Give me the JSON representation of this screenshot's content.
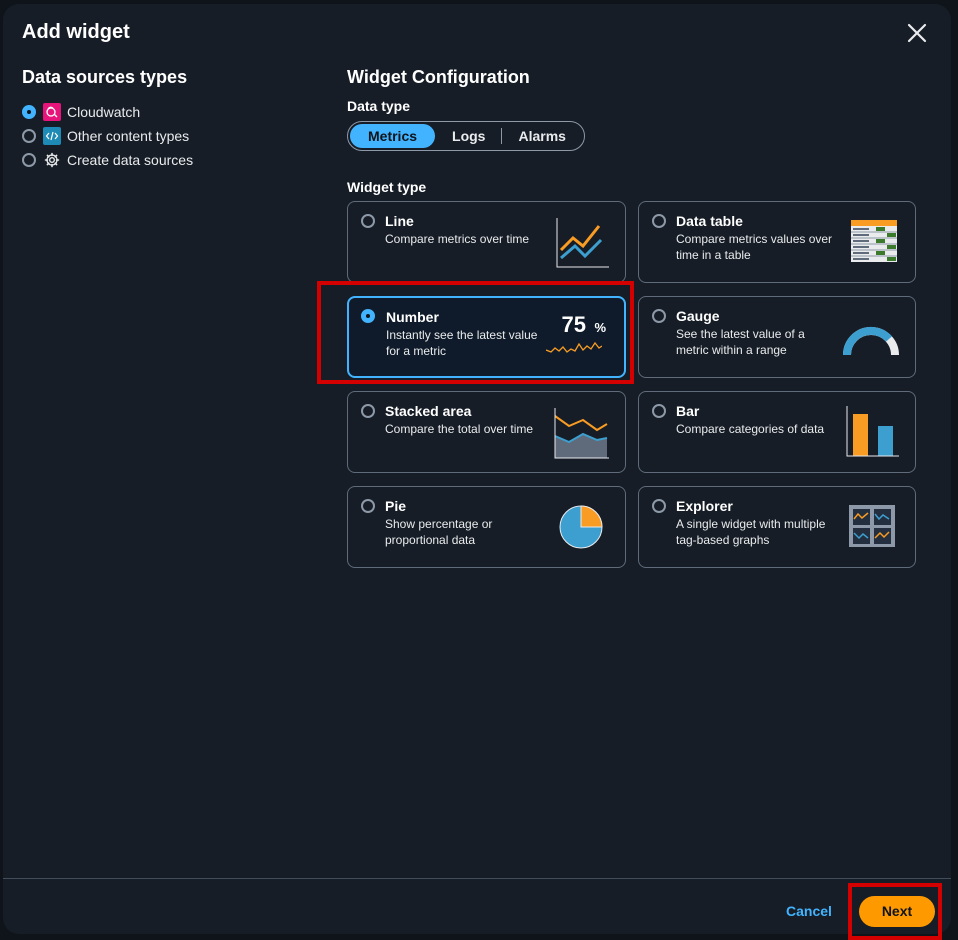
{
  "modal": {
    "title": "Add widget",
    "close_icon": "close-icon"
  },
  "data_sources": {
    "heading": "Data sources types",
    "items": [
      {
        "label": "Cloudwatch",
        "icon": "cloudwatch-icon",
        "selected": true,
        "icon_color": "#e7157b"
      },
      {
        "label": "Other content types",
        "icon": "code-icon",
        "selected": false,
        "icon_color": "#1e8ab6"
      },
      {
        "label": "Create data sources",
        "icon": "gear-icon",
        "selected": false
      }
    ]
  },
  "config": {
    "heading": "Widget Configuration",
    "data_type_label": "Data type",
    "data_types": [
      {
        "label": "Metrics",
        "active": true
      },
      {
        "label": "Logs",
        "active": false
      },
      {
        "label": "Alarms",
        "active": false
      }
    ],
    "widget_type_label": "Widget type",
    "widgets": [
      {
        "title": "Line",
        "desc": "Compare metrics over time",
        "icon": "line-chart-icon",
        "selected": false
      },
      {
        "title": "Data table",
        "desc": "Compare metrics values over time in a table",
        "icon": "data-table-icon",
        "selected": false
      },
      {
        "title": "Number",
        "desc": "Instantly see the latest value for a metric",
        "icon": "number-icon",
        "selected": true,
        "preview_value": "75",
        "preview_unit": "%"
      },
      {
        "title": "Gauge",
        "desc": "See the latest value of a metric within a range",
        "icon": "gauge-icon",
        "selected": false
      },
      {
        "title": "Stacked area",
        "desc": "Compare the total over time",
        "icon": "stacked-area-icon",
        "selected": false
      },
      {
        "title": "Bar",
        "desc": "Compare categories of data",
        "icon": "bar-chart-icon",
        "selected": false
      },
      {
        "title": "Pie",
        "desc": "Show percentage or proportional data",
        "icon": "pie-chart-icon",
        "selected": false
      },
      {
        "title": "Explorer",
        "desc": "A single widget with multiple tag-based graphs",
        "icon": "explorer-icon",
        "selected": false
      }
    ]
  },
  "footer": {
    "cancel_label": "Cancel",
    "next_label": "Next"
  },
  "colors": {
    "accent": "#42b4ff",
    "primary_button": "#ff9900",
    "highlight": "#d40000",
    "chart_orange": "#f89c24",
    "chart_blue": "#3d9fd0"
  }
}
